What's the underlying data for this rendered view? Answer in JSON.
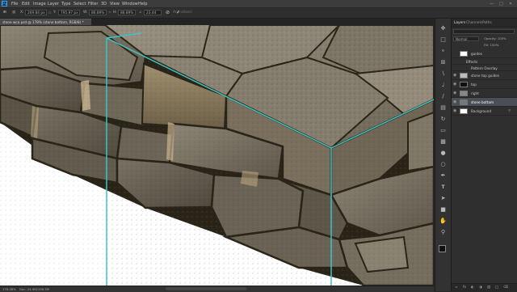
{
  "menu": {
    "logo": "Ps",
    "items": [
      "File",
      "Edit",
      "Image",
      "Layer",
      "Type",
      "Select",
      "Filter",
      "3D",
      "View",
      "Window",
      "Help"
    ]
  },
  "options": {
    "x_value": "269.84 px",
    "y_value": "795.97 px",
    "w_value": "86.89%",
    "h_value": "86.89%",
    "angle_value": "23.44",
    "antialias_label": "Anti-alias",
    "hskew": "0.00"
  },
  "document": {
    "tab_title": "stone wca psd @ 178% (stone bottom, RGB/8) *"
  },
  "status": {
    "zoom": "178.08%",
    "doc_info": "Doc: 24.9M/196.3M"
  },
  "panel": {
    "tabs": [
      "Layers",
      "Channels",
      "Paths"
    ],
    "blend_mode": "Normal",
    "opacity_label": "Opacity: 100%",
    "fill_label": "Fill: 100%",
    "layers": [
      {
        "name": "guides",
        "kind": "layer",
        "thumb": "#ffffff",
        "visible": false
      },
      {
        "name": "Effects",
        "kind": "effect",
        "thumb": "",
        "visible": false
      },
      {
        "name": "Pattern Overlay",
        "kind": "effect",
        "thumb": "",
        "visible": false
      },
      {
        "name": "stone top guides",
        "kind": "layer",
        "thumb": "#bbbbbb",
        "visible": true
      },
      {
        "name": "top",
        "kind": "layer",
        "thumb": "#111111",
        "visible": true
      },
      {
        "name": "right",
        "kind": "layer",
        "thumb": "#888888",
        "visible": true
      },
      {
        "name": "stone bottom",
        "kind": "layer",
        "thumb": "#777777",
        "visible": true,
        "selected": true
      },
      {
        "name": "Background",
        "kind": "layer",
        "thumb": "#ffffff",
        "visible": true
      }
    ]
  },
  "colors": {
    "guide": "#3ec4c4",
    "mortar": "#2a2418",
    "selected_layer": "#4a4f57"
  },
  "tool_icons": [
    "move-icon",
    "marquee-icon",
    "lasso-icon",
    "crop-icon",
    "eyedropper-icon",
    "healing-icon",
    "brush-icon",
    "stamp-icon",
    "history-brush-icon",
    "eraser-icon",
    "gradient-icon",
    "blur-icon",
    "dodge-icon",
    "pen-icon",
    "type-icon",
    "path-select-icon",
    "shape-icon",
    "hand-icon",
    "zoom-icon"
  ]
}
